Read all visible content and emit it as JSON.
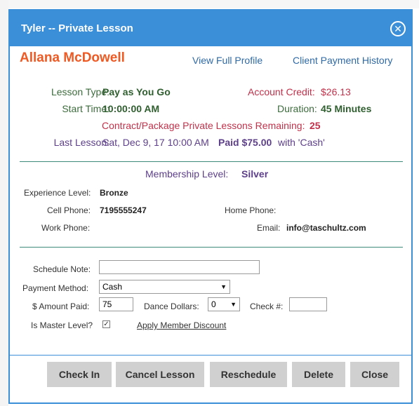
{
  "dialog": {
    "title": "Tyler -- Private Lesson"
  },
  "client": {
    "name": "Allana McDowell",
    "view_profile": "View Full Profile",
    "payment_history": "Client Payment History"
  },
  "lesson": {
    "type_label": "Lesson Type:",
    "type_value": "Pay as You Go",
    "credit_label": "Account Credit:",
    "credit_value": "$26.13",
    "start_label": "Start Time:",
    "start_value": "10:00:00 AM",
    "duration_label": "Duration:",
    "duration_value": "45 Minutes",
    "remaining_label": "Contract/Package Private Lessons Remaining:",
    "remaining_value": "25",
    "last_label": "Last Lesson:",
    "last_value": "Sat, Dec 9, 17 10:00 AM",
    "last_paid": "Paid $75.00",
    "last_with": "with 'Cash'"
  },
  "membership": {
    "label": "Membership Level:",
    "value": "Silver"
  },
  "contact": {
    "experience_label": "Experience Level:",
    "experience_value": "Bronze",
    "cell_label": "Cell Phone:",
    "cell_value": "7195555247",
    "home_label": "Home Phone:",
    "home_value": "",
    "work_label": "Work Phone:",
    "work_value": "",
    "email_label": "Email:",
    "email_value": "info@taschultz.com"
  },
  "form": {
    "schedule_note_label": "Schedule Note:",
    "schedule_note_value": "",
    "payment_method_label": "Payment Method:",
    "payment_method_value": "Cash",
    "amount_label": "$ Amount Paid:",
    "amount_value": "75",
    "dance_dollars_label": "Dance Dollars:",
    "dance_dollars_value": "0",
    "check_label": "Check #:",
    "check_value": "",
    "master_label": "Is Master Level?",
    "master_checked": true,
    "discount_link": "Apply Member Discount"
  },
  "buttons": {
    "check_in": "Check In",
    "cancel": "Cancel Lesson",
    "reschedule": "Reschedule",
    "delete": "Delete",
    "close": "Close"
  },
  "colors": {
    "accent": "#3a8fd8",
    "client_name": "#ee5a24",
    "green": "#2f5e2f",
    "red": "#c2314a",
    "purple": "#5d3f8a"
  }
}
